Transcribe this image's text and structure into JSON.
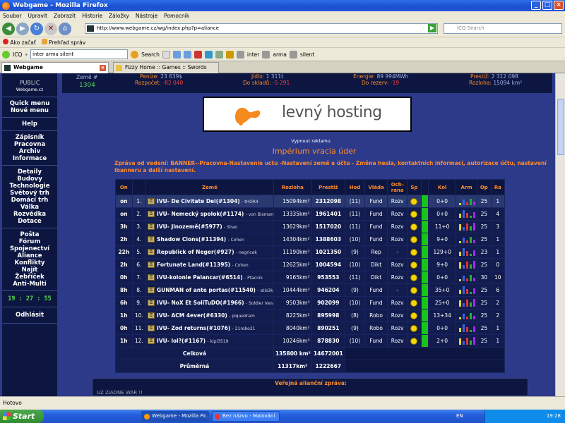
{
  "window": {
    "title": "Webgame - Mozilla Firefox"
  },
  "menu": [
    "Soubor",
    "Upravit",
    "Zobrazit",
    "Historie",
    "Záložky",
    "Nástroje",
    "Pomocník"
  ],
  "nav": {
    "url": "http://www.webgame.cz/wg/index.php?p=aliance",
    "search_placeholder": "ICQ Search"
  },
  "bookmarks": [
    "Ako začať",
    "Prehľad správ"
  ],
  "icq": {
    "label": "ICQ",
    "input": "inter arma silent",
    "search_label": "Search",
    "chips": [
      "inter",
      "arma",
      "silent"
    ]
  },
  "tabs": [
    {
      "label": "Webgame"
    },
    {
      "label": "Fizzy Home :: Games :: Swords And S..."
    }
  ],
  "sidebar": {
    "public": "PUBLIC",
    "site": "Webgame.cz",
    "group1": [
      "Quick menu",
      "Nové menu"
    ],
    "help": "Help",
    "group2": [
      "Zápisník",
      "Pracovna",
      "Archiv",
      "Informace"
    ],
    "group3": [
      "Detaily",
      "Budovy",
      "Technologie",
      "Světový trh",
      "Domácí trh",
      "Válka",
      "Rozvědka",
      "Dotace"
    ],
    "group4": [
      "Pošta",
      "Fórum",
      "Spojenectví",
      "Aliance",
      "Konflikty",
      "Najít",
      "Žebříček",
      "Anti-Multi"
    ],
    "clock": "19 : 27 : 55",
    "logout": "Odhlásit"
  },
  "stats": {
    "zeme_label": "Země #",
    "zeme_num": "1304",
    "penize_label": "Peníze:",
    "penize": "23 639$",
    "rozpocet_label": "Rozpočet:",
    "rozpocet": "-82 040",
    "jidlo_label": "Jídlo:",
    "jidlo": "1 311t",
    "doskladu_label": "Do skladů:",
    "doskladu": "-5 291",
    "energie_label": "Energie:",
    "energie": "89 994MWh",
    "dorezerv_label": "Do rezerv:",
    "dorezerv": "-19",
    "prestiz_label": "Prestiž:",
    "prestiz": "2 312 098",
    "rozloha_label": "Rozloha:",
    "rozloha": "15094 km²"
  },
  "banner": {
    "text": "levný hosting",
    "link": "levny-hosting.cz - kvalita pro každého",
    "off": "Vypnout reklamu"
  },
  "alliance": {
    "title": "Impérium vracia úder",
    "message": "Zpráva od vedení: BANNER--Pracovna-Nastavenie uctu -Nastavení země a účtu - Změna hesla, kontaktních informací, autorizace účtu, nastavení ibanneru a další nastavení."
  },
  "columns": [
    "On",
    "",
    "Země",
    "Rozloha",
    "Prestiž",
    "Hod",
    "Vláda",
    "Och-rana",
    "Sp",
    "Kol",
    "Arm",
    "Op",
    "Ra"
  ],
  "rows": [
    {
      "on": "on",
      "n": "1.",
      "name": "IVU- De Civitate Dei(#1304)",
      "player": "tHOR4",
      "area": "15094km²",
      "prestige": "2312098",
      "hod": "(11)",
      "gov": "Fund",
      "prot": "Rozv",
      "kol": "0+0",
      "op": "25",
      "ra": "1"
    },
    {
      "on": "on",
      "n": "2.",
      "name": "IVU- Nemecký spolok(#1174)",
      "player": "von Bismarck",
      "area": "13335km²",
      "prestige": "1961401",
      "hod": "(11)",
      "gov": "Fund",
      "prot": "Rozv",
      "kol": "0+0",
      "op": "25",
      "ra": "4"
    },
    {
      "on": "3h",
      "n": "3.",
      "name": "IVU- Jinozemě(#5977)",
      "player": "Shao",
      "area": "13629km²",
      "prestige": "1517020",
      "hod": "(11)",
      "gov": "Fund",
      "prot": "Rozv",
      "kol": "11+0",
      "op": "25",
      "ra": "3"
    },
    {
      "on": "2h",
      "n": "4.",
      "name": "Shadow Clons(#11394)",
      "player": "Cohen",
      "area": "14304km²",
      "prestige": "1388603",
      "hod": "(10)",
      "gov": "Fund",
      "prot": "Rozv",
      "kol": "9+0",
      "op": "25",
      "ra": "1"
    },
    {
      "on": "22h",
      "n": "5.",
      "name": "Republick of Neger(#927)",
      "player": "negricek",
      "area": "11190km²",
      "prestige": "1021350",
      "hod": "(9)",
      "gov": "Rep",
      "prot": "-",
      "kol": "129+0",
      "op": "23",
      "ra": "1"
    },
    {
      "on": "2h",
      "n": "6.",
      "name": "Fortunate Land(#11395)",
      "player": "Cohen",
      "area": "12625km²",
      "prestige": "1004594",
      "hod": "(10)",
      "gov": "Dikt",
      "prot": "Rozv",
      "kol": "9+0",
      "op": "25",
      "ra": "0"
    },
    {
      "on": "0h",
      "n": "7.",
      "name": "IVU-kolonie Palancar(#6514)",
      "player": "Ptacnik",
      "area": "9165km²",
      "prestige": "953553",
      "hod": "(11)",
      "gov": "Dikt",
      "prot": "Rozv",
      "kol": "0+0",
      "op": "30",
      "ra": "10"
    },
    {
      "on": "8h",
      "n": "8.",
      "name": "GUNMAN of ante portas(#11540)",
      "player": "atis3k",
      "area": "10444km²",
      "prestige": "946204",
      "hod": "(9)",
      "gov": "Fund",
      "prot": "-",
      "kol": "35+0",
      "op": "25",
      "ra": "6"
    },
    {
      "on": "6h",
      "n": "9.",
      "name": "IVU- NoX Et SoliTuDO(#1966)",
      "player": "Soldier Vana",
      "area": "9503km²",
      "prestige": "902099",
      "hod": "(10)",
      "gov": "Fund",
      "prot": "Rozv",
      "kol": "25+0",
      "op": "25",
      "ra": "2"
    },
    {
      "on": "1h",
      "n": "10.",
      "name": "IVU- ACM 4ever(#6330)",
      "player": "piquedram",
      "area": "8225km²",
      "prestige": "895998",
      "hod": "(8)",
      "gov": "Robo",
      "prot": "Rozv",
      "kol": "13+34",
      "op": "25",
      "ra": "2"
    },
    {
      "on": "0h",
      "n": "11.",
      "name": "IVU- Zod returns(#1076)",
      "player": "21robo21",
      "area": "8040km²",
      "prestige": "890251",
      "hod": "(9)",
      "gov": "Robo",
      "prot": "Rozv",
      "kol": "0+0",
      "op": "25",
      "ra": "1"
    },
    {
      "on": "1h",
      "n": "12.",
      "name": "IVU- lol?(#1167)",
      "player": "kipi3519",
      "area": "10246km²",
      "prestige": "878830",
      "hod": "(10)",
      "gov": "Fund",
      "prot": "Rozv",
      "kol": "2+0",
      "op": "25",
      "ra": "1"
    }
  ],
  "totals": {
    "celkova_label": "Celková",
    "celkova_area": "135800 km²",
    "celkova_prestige": "14672001",
    "prumerna_label": "Průměrná",
    "prumerna_area": "11317km²",
    "prumerna_prestige": "1222667"
  },
  "public_msg": {
    "title": "Veřejná alianční zpráva:",
    "text": "UZ ZIADNE WAR !!"
  },
  "status": "Hotovo",
  "taskbar": {
    "start": "Start",
    "tasks": [
      "Webgame - Mozilla Fir...",
      "Bez názvu - Malování"
    ],
    "lang": "EN",
    "time": "19:28"
  }
}
